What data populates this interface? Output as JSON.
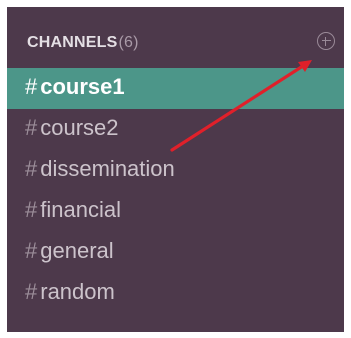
{
  "sidebar": {
    "header": {
      "title": "CHANNELS",
      "count": "(6)",
      "add_icon": "plus-circle-icon"
    },
    "hash_symbol": "#",
    "channels": [
      {
        "name": "course1",
        "active": true
      },
      {
        "name": "course2",
        "active": false
      },
      {
        "name": "dissemination",
        "active": false
      },
      {
        "name": "financial",
        "active": false
      },
      {
        "name": "general",
        "active": false
      },
      {
        "name": "random",
        "active": false
      }
    ]
  },
  "colors": {
    "sidebar_bg": "#4d394b",
    "active_bg": "#4c9689",
    "annotation_arrow": "#e0202a"
  }
}
